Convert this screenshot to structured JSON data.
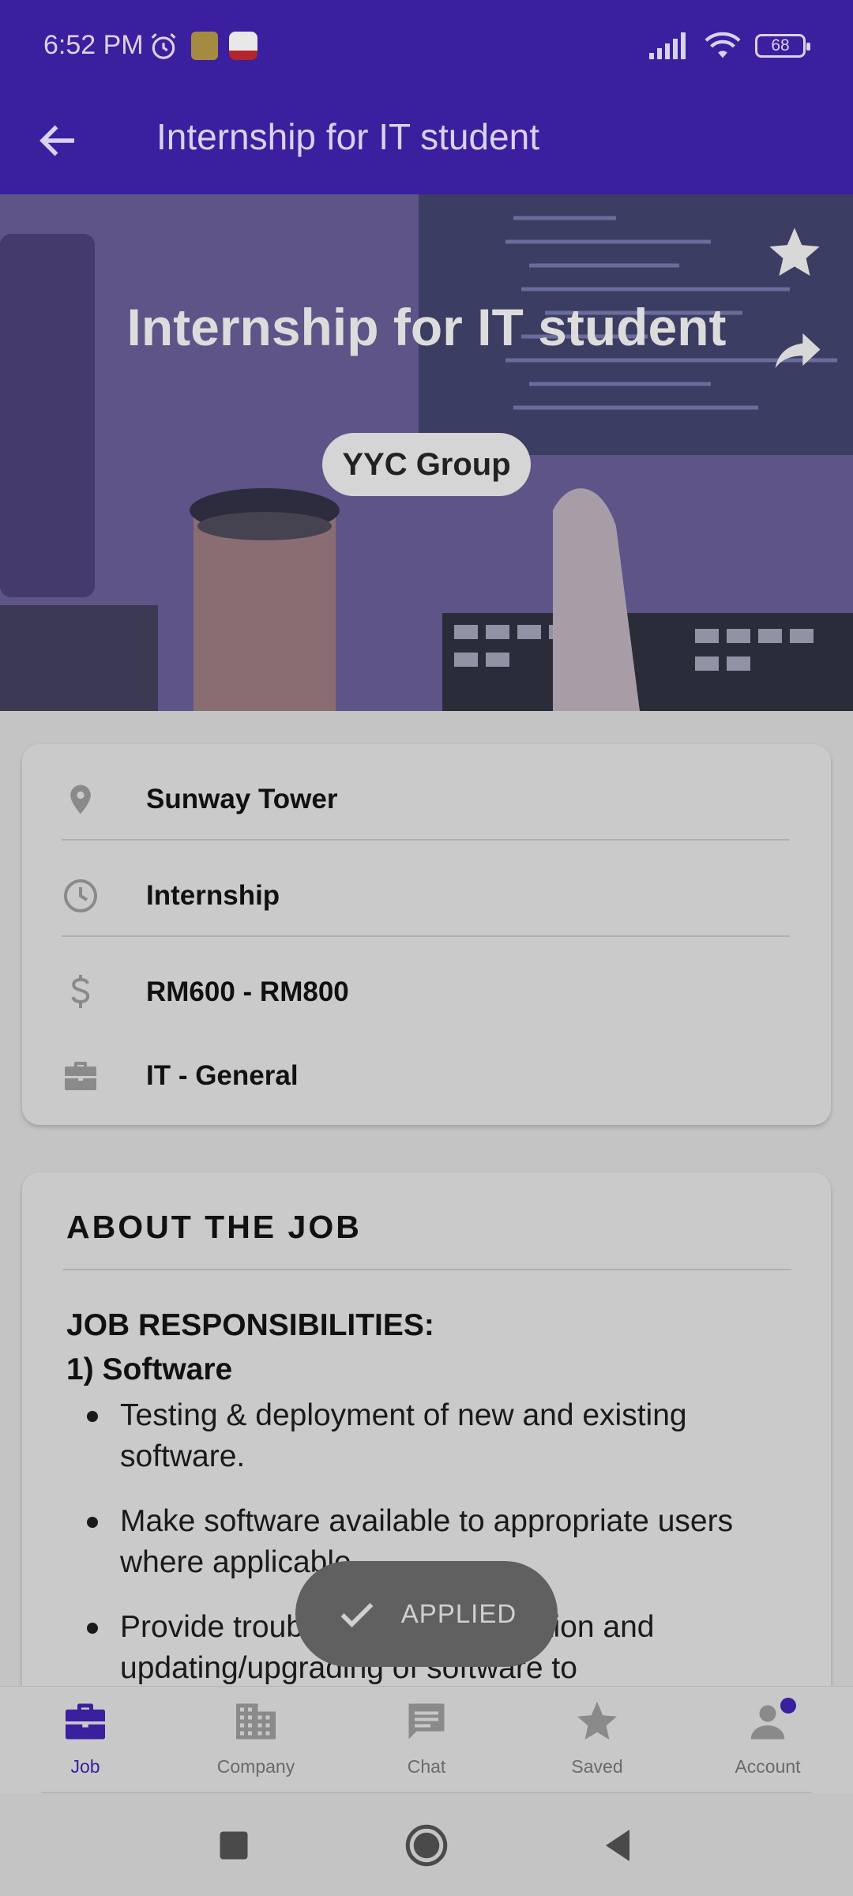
{
  "status_bar": {
    "time": "6:52 PM",
    "battery": "68",
    "icons": [
      "alarm-icon",
      "app-notification-icon",
      "news-notification-icon",
      "signal-icon",
      "wifi-icon",
      "battery-icon"
    ]
  },
  "app_bar": {
    "title": "Internship for IT student",
    "back_icon": "arrow-back-icon"
  },
  "hero": {
    "title": "Internship for IT student",
    "company": "YYC Group",
    "actions": [
      "star-icon",
      "share-icon"
    ]
  },
  "job_info": {
    "location": "Sunway Tower",
    "type": "Internship",
    "salary": "RM600 - RM800",
    "category": "IT - General"
  },
  "about": {
    "heading": "ABOUT THE JOB",
    "responsibilities_heading": "JOB RESPONSIBILITIES:",
    "section_1": "1) Software",
    "bullets": [
      "Testing & deployment of new and existing software.",
      "Make software available to appropriate users where applicable.",
      "Provide troubleshooting, resolution and updating/upgrading of software to"
    ]
  },
  "toast": {
    "label": "APPLIED"
  },
  "bottom_nav": {
    "items": [
      {
        "label": "Job",
        "icon": "briefcase-icon",
        "active": true
      },
      {
        "label": "Company",
        "icon": "building-icon",
        "active": false
      },
      {
        "label": "Chat",
        "icon": "chat-icon",
        "active": false
      },
      {
        "label": "Saved",
        "icon": "star-icon",
        "active": false
      },
      {
        "label": "Account",
        "icon": "person-icon",
        "active": false
      }
    ]
  },
  "colors": {
    "primary": "#3a1f9e",
    "scrim_background": "#c4c4c4",
    "toast": "#606060"
  }
}
